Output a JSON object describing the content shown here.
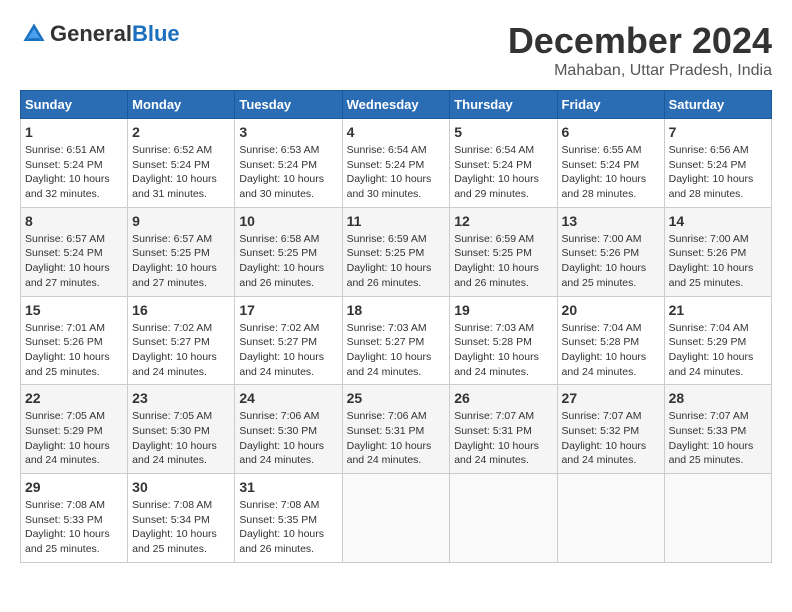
{
  "header": {
    "logo_general": "General",
    "logo_blue": "Blue",
    "month": "December 2024",
    "location": "Mahaban, Uttar Pradesh, India"
  },
  "weekdays": [
    "Sunday",
    "Monday",
    "Tuesday",
    "Wednesday",
    "Thursday",
    "Friday",
    "Saturday"
  ],
  "weeks": [
    [
      {
        "day": "1",
        "sunrise": "6:51 AM",
        "sunset": "5:24 PM",
        "daylight": "10 hours and 32 minutes."
      },
      {
        "day": "2",
        "sunrise": "6:52 AM",
        "sunset": "5:24 PM",
        "daylight": "10 hours and 31 minutes."
      },
      {
        "day": "3",
        "sunrise": "6:53 AM",
        "sunset": "5:24 PM",
        "daylight": "10 hours and 30 minutes."
      },
      {
        "day": "4",
        "sunrise": "6:54 AM",
        "sunset": "5:24 PM",
        "daylight": "10 hours and 30 minutes."
      },
      {
        "day": "5",
        "sunrise": "6:54 AM",
        "sunset": "5:24 PM",
        "daylight": "10 hours and 29 minutes."
      },
      {
        "day": "6",
        "sunrise": "6:55 AM",
        "sunset": "5:24 PM",
        "daylight": "10 hours and 28 minutes."
      },
      {
        "day": "7",
        "sunrise": "6:56 AM",
        "sunset": "5:24 PM",
        "daylight": "10 hours and 28 minutes."
      }
    ],
    [
      {
        "day": "8",
        "sunrise": "6:57 AM",
        "sunset": "5:24 PM",
        "daylight": "10 hours and 27 minutes."
      },
      {
        "day": "9",
        "sunrise": "6:57 AM",
        "sunset": "5:25 PM",
        "daylight": "10 hours and 27 minutes."
      },
      {
        "day": "10",
        "sunrise": "6:58 AM",
        "sunset": "5:25 PM",
        "daylight": "10 hours and 26 minutes."
      },
      {
        "day": "11",
        "sunrise": "6:59 AM",
        "sunset": "5:25 PM",
        "daylight": "10 hours and 26 minutes."
      },
      {
        "day": "12",
        "sunrise": "6:59 AM",
        "sunset": "5:25 PM",
        "daylight": "10 hours and 26 minutes."
      },
      {
        "day": "13",
        "sunrise": "7:00 AM",
        "sunset": "5:26 PM",
        "daylight": "10 hours and 25 minutes."
      },
      {
        "day": "14",
        "sunrise": "7:00 AM",
        "sunset": "5:26 PM",
        "daylight": "10 hours and 25 minutes."
      }
    ],
    [
      {
        "day": "15",
        "sunrise": "7:01 AM",
        "sunset": "5:26 PM",
        "daylight": "10 hours and 25 minutes."
      },
      {
        "day": "16",
        "sunrise": "7:02 AM",
        "sunset": "5:27 PM",
        "daylight": "10 hours and 24 minutes."
      },
      {
        "day": "17",
        "sunrise": "7:02 AM",
        "sunset": "5:27 PM",
        "daylight": "10 hours and 24 minutes."
      },
      {
        "day": "18",
        "sunrise": "7:03 AM",
        "sunset": "5:27 PM",
        "daylight": "10 hours and 24 minutes."
      },
      {
        "day": "19",
        "sunrise": "7:03 AM",
        "sunset": "5:28 PM",
        "daylight": "10 hours and 24 minutes."
      },
      {
        "day": "20",
        "sunrise": "7:04 AM",
        "sunset": "5:28 PM",
        "daylight": "10 hours and 24 minutes."
      },
      {
        "day": "21",
        "sunrise": "7:04 AM",
        "sunset": "5:29 PM",
        "daylight": "10 hours and 24 minutes."
      }
    ],
    [
      {
        "day": "22",
        "sunrise": "7:05 AM",
        "sunset": "5:29 PM",
        "daylight": "10 hours and 24 minutes."
      },
      {
        "day": "23",
        "sunrise": "7:05 AM",
        "sunset": "5:30 PM",
        "daylight": "10 hours and 24 minutes."
      },
      {
        "day": "24",
        "sunrise": "7:06 AM",
        "sunset": "5:30 PM",
        "daylight": "10 hours and 24 minutes."
      },
      {
        "day": "25",
        "sunrise": "7:06 AM",
        "sunset": "5:31 PM",
        "daylight": "10 hours and 24 minutes."
      },
      {
        "day": "26",
        "sunrise": "7:07 AM",
        "sunset": "5:31 PM",
        "daylight": "10 hours and 24 minutes."
      },
      {
        "day": "27",
        "sunrise": "7:07 AM",
        "sunset": "5:32 PM",
        "daylight": "10 hours and 24 minutes."
      },
      {
        "day": "28",
        "sunrise": "7:07 AM",
        "sunset": "5:33 PM",
        "daylight": "10 hours and 25 minutes."
      }
    ],
    [
      {
        "day": "29",
        "sunrise": "7:08 AM",
        "sunset": "5:33 PM",
        "daylight": "10 hours and 25 minutes."
      },
      {
        "day": "30",
        "sunrise": "7:08 AM",
        "sunset": "5:34 PM",
        "daylight": "10 hours and 25 minutes."
      },
      {
        "day": "31",
        "sunrise": "7:08 AM",
        "sunset": "5:35 PM",
        "daylight": "10 hours and 26 minutes."
      },
      null,
      null,
      null,
      null
    ]
  ],
  "labels": {
    "sunrise": "Sunrise:",
    "sunset": "Sunset:",
    "daylight": "Daylight:"
  }
}
